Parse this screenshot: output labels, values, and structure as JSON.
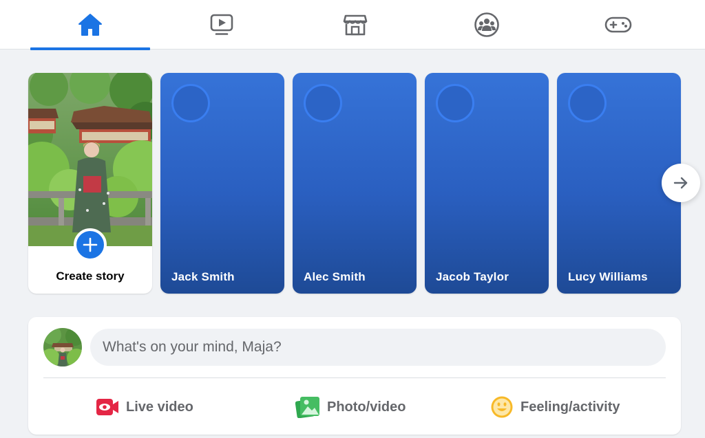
{
  "nav": {
    "tabs": [
      {
        "id": "home",
        "icon": "home-icon",
        "active": true
      },
      {
        "id": "watch",
        "icon": "video-play-icon",
        "active": false
      },
      {
        "id": "marketplace",
        "icon": "storefront-icon",
        "active": false
      },
      {
        "id": "groups",
        "icon": "groups-icon",
        "active": false
      },
      {
        "id": "gaming",
        "icon": "gamepad-icon",
        "active": false
      }
    ],
    "accent_color": "#1b74e4"
  },
  "stories": {
    "create": {
      "label": "Create story",
      "icon": "plus-icon"
    },
    "friends": [
      {
        "name": "Jack Smith"
      },
      {
        "name": "Alec Smith"
      },
      {
        "name": "Jacob Taylor"
      },
      {
        "name": "Lucy Williams"
      }
    ],
    "next_icon": "arrow-right-icon",
    "card_color": "#2a5fc0"
  },
  "composer": {
    "placeholder": "What's on your mind, Maja?",
    "actions": [
      {
        "label": "Live video",
        "icon": "live-video-icon",
        "color": "#e42645"
      },
      {
        "label": "Photo/video",
        "icon": "photo-icon",
        "color": "#45bd62"
      },
      {
        "label": "Feeling/activity",
        "icon": "smiley-icon",
        "color": "#f7b928"
      }
    ]
  }
}
